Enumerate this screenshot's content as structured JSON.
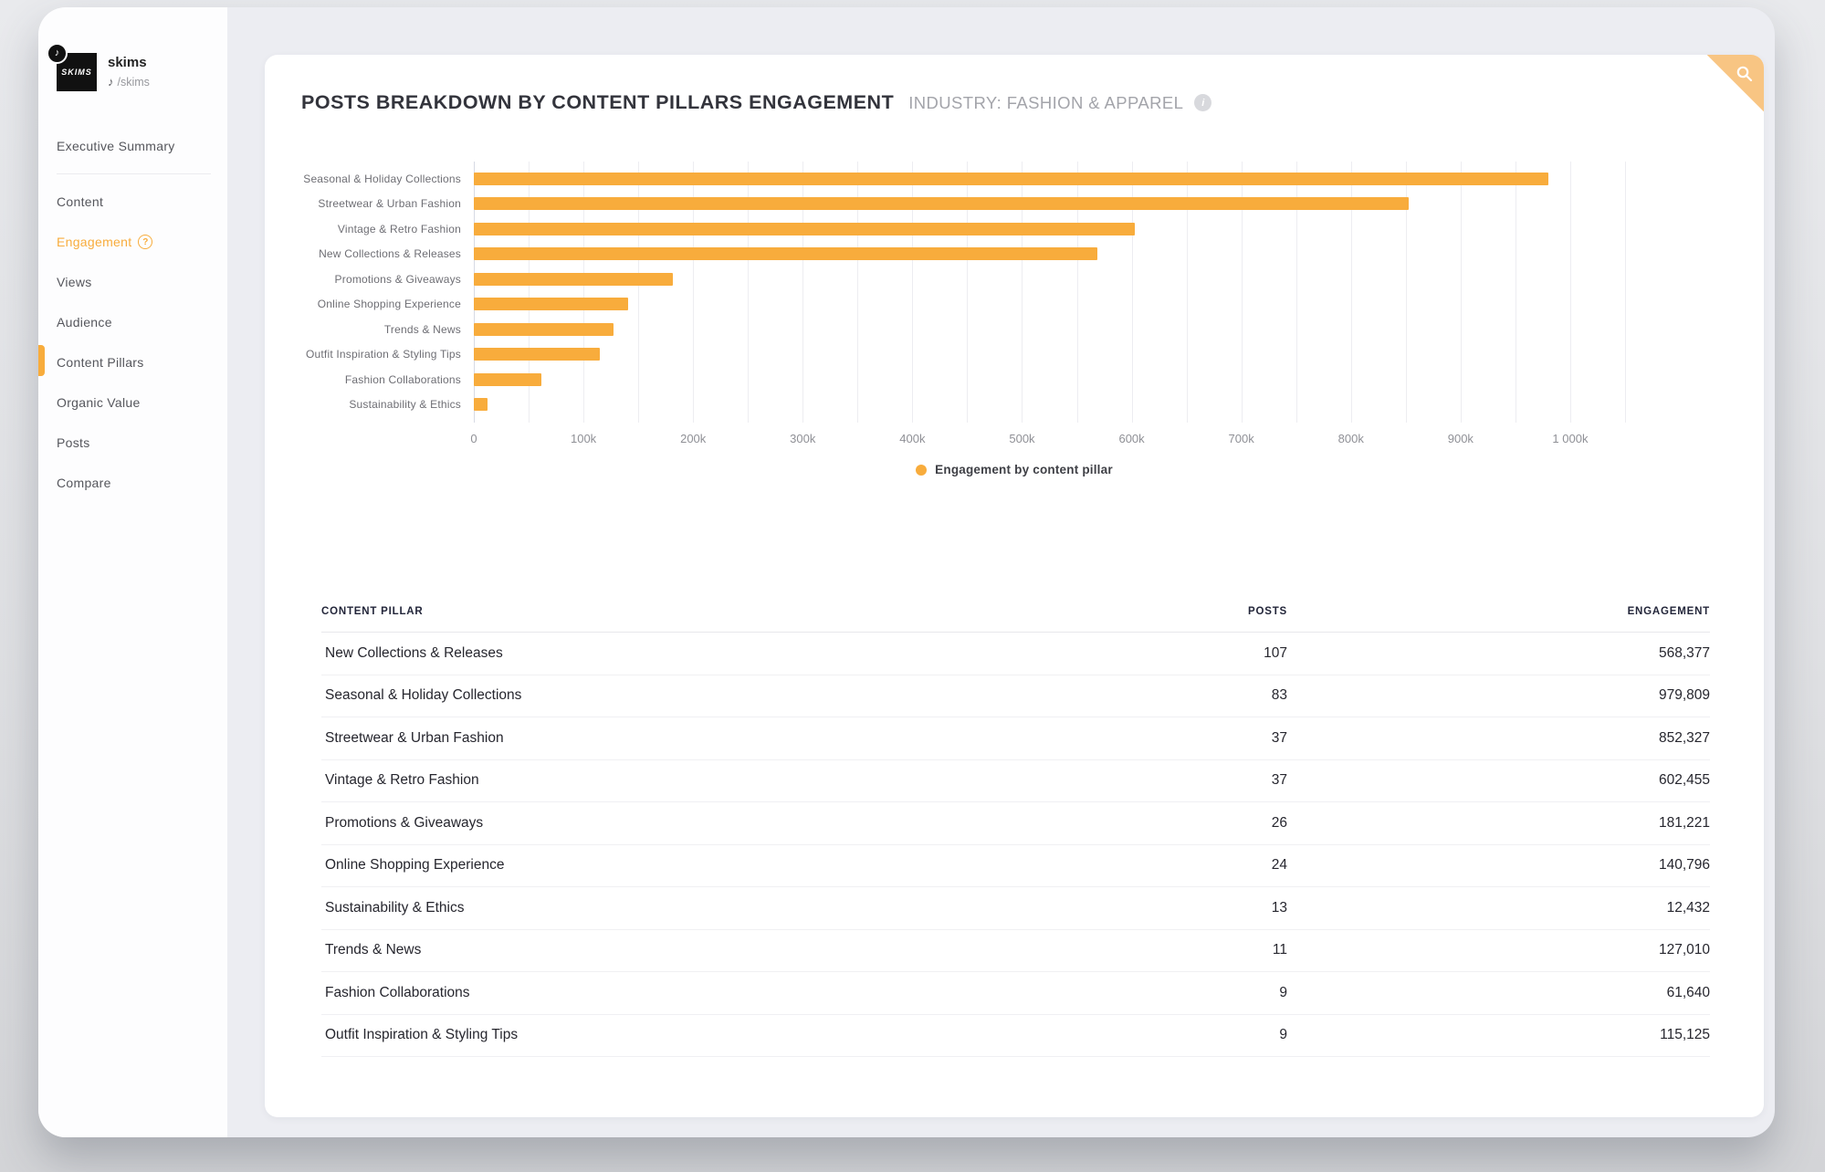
{
  "colors": {
    "accent": "#F8AC3C",
    "corner_triangle": "#F8C583"
  },
  "sidebar": {
    "brand": {
      "logo_text": "SKIMS",
      "name": "skims",
      "handle": "/skims",
      "tiktok_note": "♪"
    },
    "items": [
      {
        "label": "Executive Summary",
        "active": false,
        "divider_after": true
      },
      {
        "label": "Content",
        "active": false
      },
      {
        "label": "Engagement",
        "active": true,
        "has_help": true
      },
      {
        "label": "Views",
        "active": false
      },
      {
        "label": "Audience",
        "active": false
      },
      {
        "label": "Content Pillars",
        "active": false
      },
      {
        "label": "Organic Value",
        "active": false
      },
      {
        "label": "Posts",
        "active": false
      },
      {
        "label": "Compare",
        "active": false
      }
    ]
  },
  "header": {
    "title": "POSTS BREAKDOWN BY CONTENT PILLARS ENGAGEMENT",
    "subtitle": "INDUSTRY: FASHION & APPAREL",
    "info_glyph": "i"
  },
  "chart_data": {
    "type": "bar",
    "orientation": "horizontal",
    "title": "Posts breakdown by content pillars engagement",
    "categories": [
      "Seasonal & Holiday Collections",
      "Streetwear & Urban Fashion",
      "Vintage & Retro Fashion",
      "New Collections & Releases",
      "Promotions & Giveaways",
      "Online Shopping Experience",
      "Trends & News",
      "Outfit Inspiration & Styling Tips",
      "Fashion Collaborations",
      "Sustainability & Ethics"
    ],
    "values": [
      979809,
      852327,
      602455,
      568377,
      181221,
      140796,
      127010,
      115125,
      61640,
      12432
    ],
    "xlim": [
      0,
      1050000
    ],
    "x_ticks": [
      "0",
      "100k",
      "200k",
      "300k",
      "400k",
      "500k",
      "600k",
      "700k",
      "800k",
      "900k",
      "1 000k"
    ],
    "tick_interval": 100000,
    "grid_interval": 50000,
    "grid": true,
    "legend": "Engagement by content pillar",
    "legend_position": "bottom"
  },
  "table": {
    "columns": [
      "Content pillar",
      "Posts",
      "Engagement"
    ],
    "rows": [
      {
        "pillar": "New Collections & Releases",
        "posts": "107",
        "engagement": "568,377"
      },
      {
        "pillar": "Seasonal & Holiday Collections",
        "posts": "83",
        "engagement": "979,809"
      },
      {
        "pillar": "Streetwear & Urban Fashion",
        "posts": "37",
        "engagement": "852,327"
      },
      {
        "pillar": "Vintage & Retro Fashion",
        "posts": "37",
        "engagement": "602,455"
      },
      {
        "pillar": "Promotions & Giveaways",
        "posts": "26",
        "engagement": "181,221"
      },
      {
        "pillar": "Online Shopping Experience",
        "posts": "24",
        "engagement": "140,796"
      },
      {
        "pillar": "Sustainability & Ethics",
        "posts": "13",
        "engagement": "12,432"
      },
      {
        "pillar": "Trends & News",
        "posts": "11",
        "engagement": "127,010"
      },
      {
        "pillar": "Fashion Collaborations",
        "posts": "9",
        "engagement": "61,640"
      },
      {
        "pillar": "Outfit Inspiration & Styling Tips",
        "posts": "9",
        "engagement": "115,125"
      }
    ]
  }
}
